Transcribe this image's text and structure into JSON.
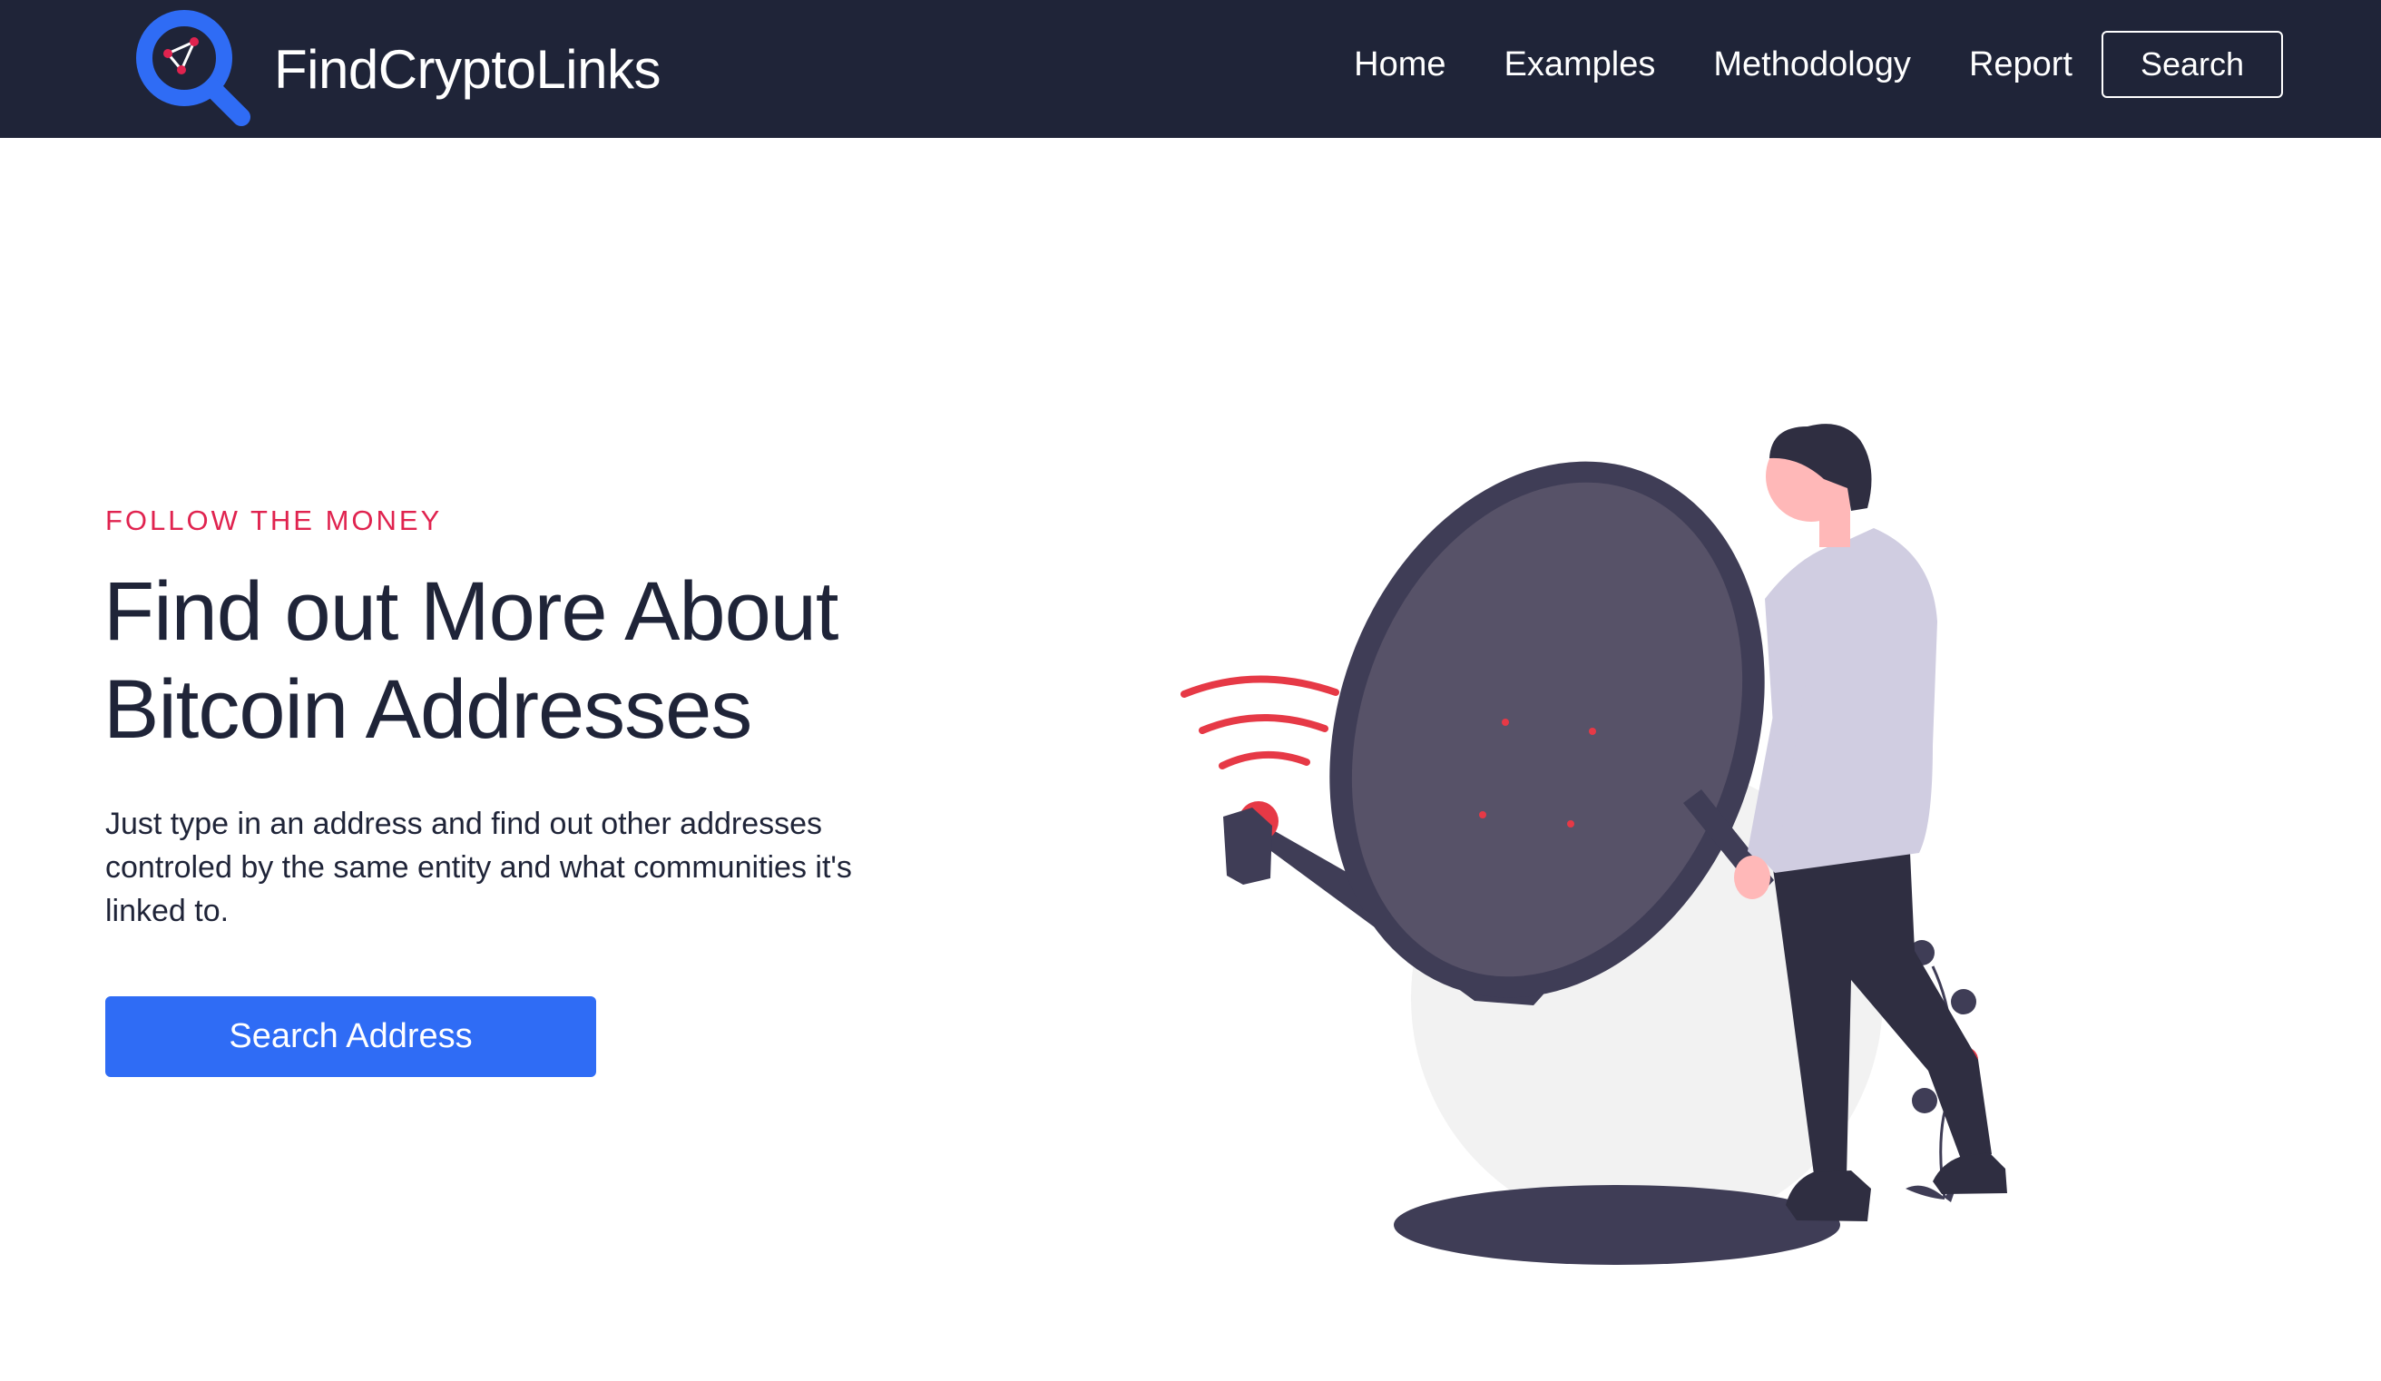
{
  "navbar": {
    "brand_name": "FindCryptoLinks",
    "logo_icon": "magnifier-network-icon",
    "links": [
      "Home",
      "Examples",
      "Methodology",
      "Report"
    ],
    "search_label": "Search"
  },
  "hero": {
    "eyebrow": "FOLLOW THE MONEY",
    "title_line1": "Find out More About",
    "title_line2": "Bitcoin Addresses",
    "description": "Just type in an address and find out other addresses controled by the same entity and what communities it's linked to.",
    "cta_label": "Search Address"
  },
  "illustration": {
    "name": "person-with-satellite-dish-illustration"
  },
  "colors": {
    "navbar_bg": "#1f2438",
    "accent_red": "#e0234f",
    "cta_blue": "#2f6cf5",
    "heading": "#1f2438"
  }
}
